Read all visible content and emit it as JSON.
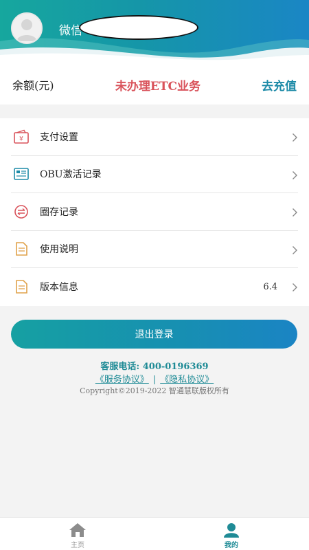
{
  "header": {
    "nickname_label": "微信"
  },
  "balance": {
    "label": "余额(元)",
    "etc_status": "未办理ETC业务",
    "recharge_label": "去充值"
  },
  "menu": {
    "items": [
      {
        "label": "支付设置",
        "icon": "wallet-icon",
        "value": ""
      },
      {
        "label": "OBU激活记录",
        "icon": "obu-device-icon",
        "value": ""
      },
      {
        "label": "圈存记录",
        "icon": "exchange-icon",
        "value": ""
      },
      {
        "label": "使用说明",
        "icon": "document-icon",
        "value": ""
      },
      {
        "label": "版本信息",
        "icon": "document-icon",
        "value": "6.4"
      }
    ]
  },
  "logout": {
    "label": "退出登录"
  },
  "footer": {
    "service_phone": "客服电话: 400-0196369",
    "service_agreement": "《服务协议》",
    "separator": "|",
    "privacy_agreement": "《隐私协议》",
    "copyright": "Copyright©2019-2022 智通慧联版权所有"
  },
  "tabbar": {
    "home_label": "主页",
    "mine_label": "我的",
    "active_color": "#1f8b96",
    "inactive_color": "#999999"
  },
  "colors": {
    "accent": "#1c8aa7",
    "status_red": "#d9535b"
  }
}
